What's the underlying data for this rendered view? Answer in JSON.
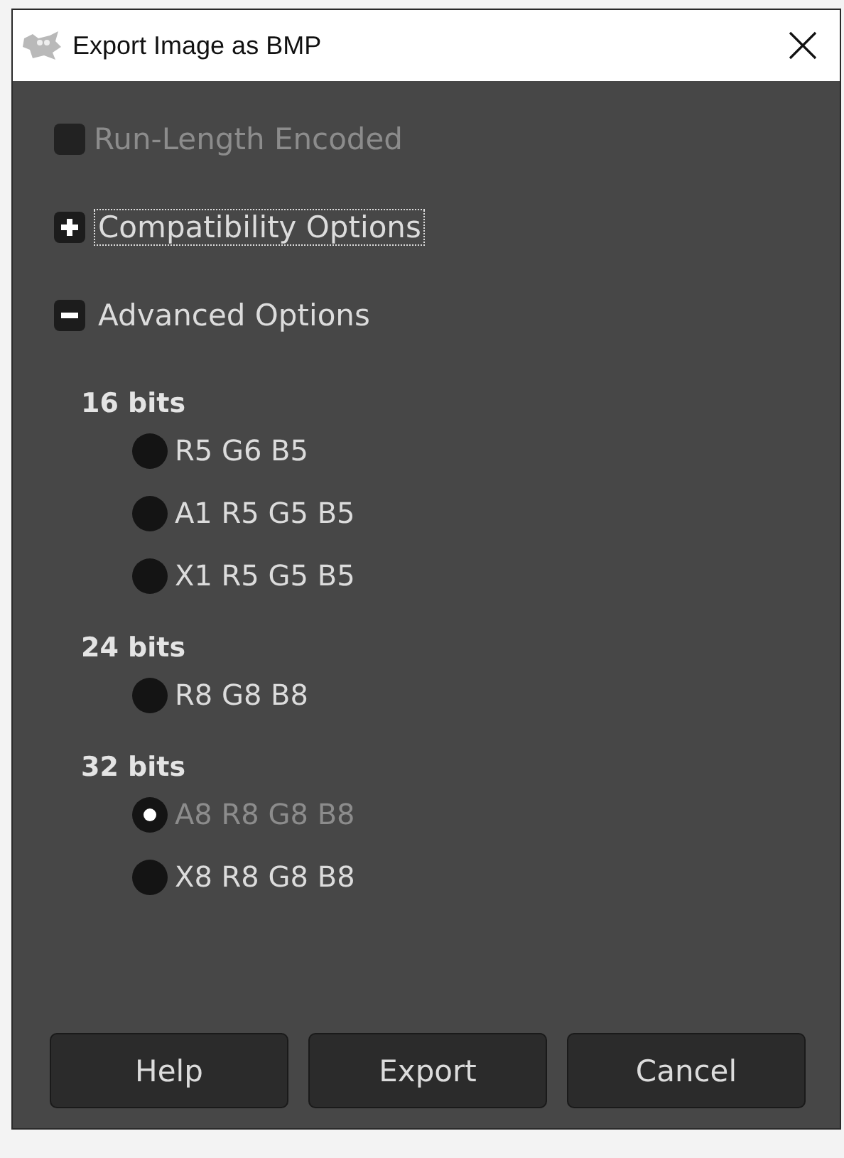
{
  "window": {
    "title": "Export Image as BMP"
  },
  "run_length": {
    "label": "Run-Length Encoded",
    "checked": false,
    "disabled": true
  },
  "expanders": [
    {
      "label": "Compatibility Options",
      "expanded": false,
      "focused": true
    },
    {
      "label": "Advanced Options",
      "expanded": true,
      "focused": false
    }
  ],
  "groups": [
    {
      "title": "16 bits",
      "options": [
        {
          "label": "R5 G6 B5",
          "selected": false,
          "disabled": false
        },
        {
          "label": "A1 R5 G5 B5",
          "selected": false,
          "disabled": false
        },
        {
          "label": "X1 R5 G5 B5",
          "selected": false,
          "disabled": false
        }
      ]
    },
    {
      "title": "24 bits",
      "options": [
        {
          "label": "R8 G8 B8",
          "selected": false,
          "disabled": false
        }
      ]
    },
    {
      "title": "32 bits",
      "options": [
        {
          "label": "A8 R8 G8 B8",
          "selected": true,
          "disabled": true
        },
        {
          "label": "X8 R8 G8 B8",
          "selected": false,
          "disabled": false
        }
      ]
    }
  ],
  "buttons": [
    "Help",
    "Export",
    "Cancel"
  ]
}
